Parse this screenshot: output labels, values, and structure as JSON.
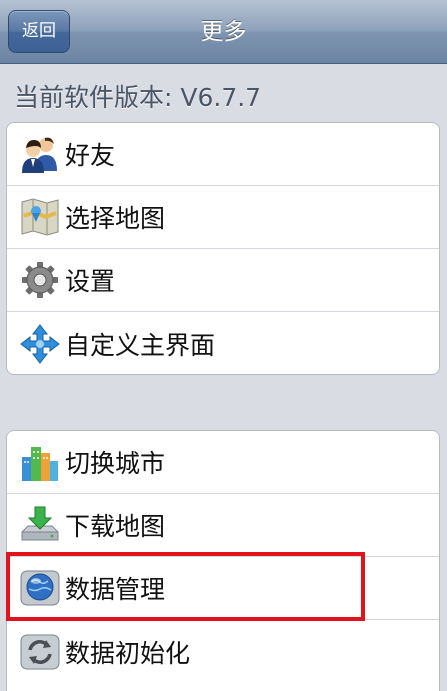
{
  "navbar": {
    "back_label": "返回",
    "title": "更多"
  },
  "version_text": "当前软件版本: V6.7.7",
  "groups": [
    {
      "items": [
        {
          "label": "好友",
          "icon": "friends-icon"
        },
        {
          "label": "选择地图",
          "icon": "map-select-icon"
        },
        {
          "label": "设置",
          "icon": "gear-icon"
        },
        {
          "label": "自定义主界面",
          "icon": "arrows-move-icon"
        }
      ]
    },
    {
      "items": [
        {
          "label": "切换城市",
          "icon": "city-buildings-icon"
        },
        {
          "label": "下载地图",
          "icon": "download-icon"
        },
        {
          "label": "数据管理",
          "icon": "globe-disk-icon"
        },
        {
          "label": "数据初始化",
          "icon": "refresh-icon"
        }
      ]
    }
  ],
  "colors": {
    "highlight": "#e0141c",
    "navbar": "#7e94b0"
  }
}
